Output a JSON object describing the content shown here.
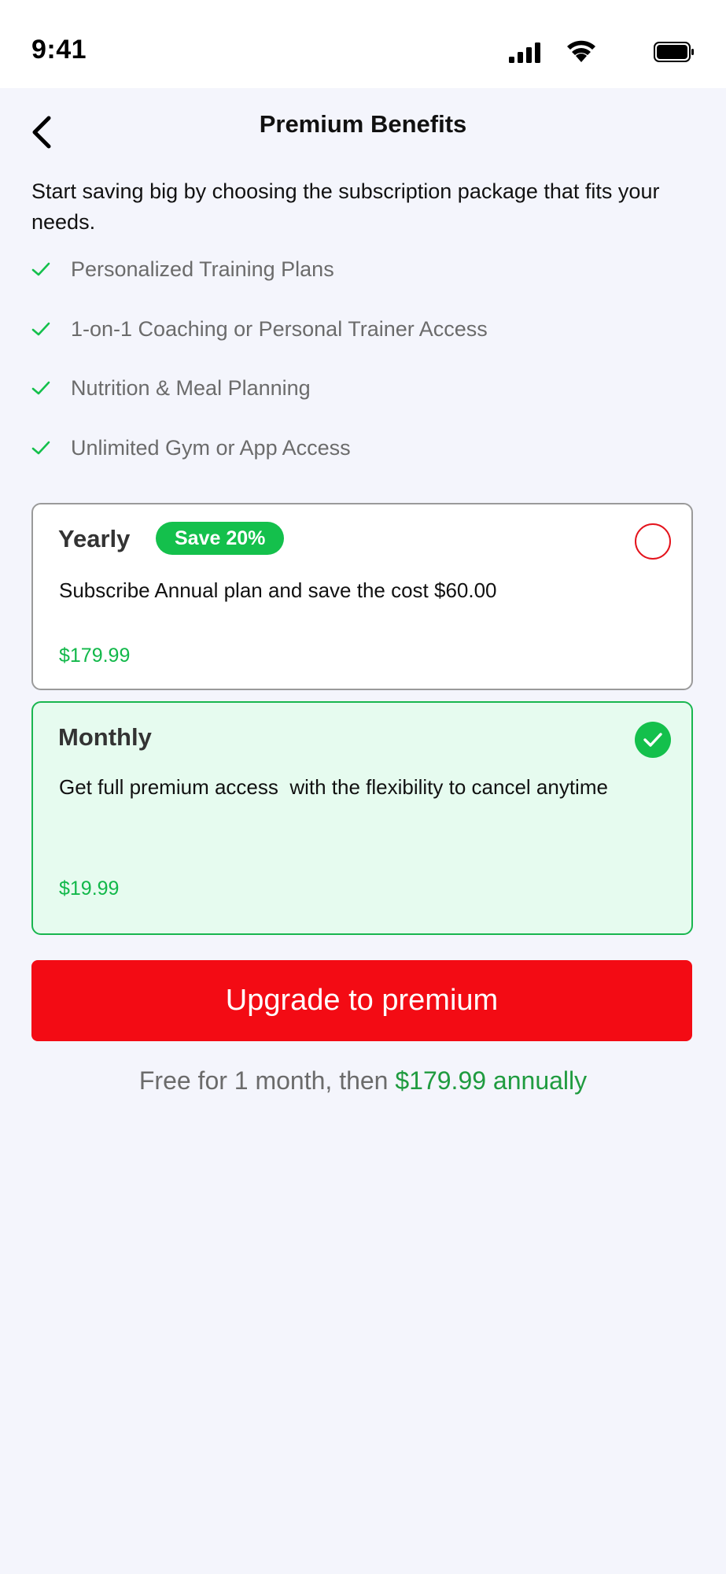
{
  "status_bar": {
    "time": "9:41",
    "icons": [
      "signal-icon",
      "wifi-icon",
      "battery-icon"
    ]
  },
  "header": {
    "title": "Premium Benefits",
    "back_icon": "chevron-left-icon"
  },
  "intro_text": "Start saving big by choosing the subscription package that fits your needs.",
  "benefits": [
    "Personalized Training Plans",
    "1-on-1 Coaching or Personal Trainer Access",
    "Nutrition & Meal Planning",
    "Unlimited Gym or App Access"
  ],
  "plans": {
    "yearly": {
      "name": "Yearly",
      "badge": "Save 20%",
      "description": "Subscribe Annual plan and save the cost $60.00",
      "price": "$179.99",
      "selected": false
    },
    "monthly": {
      "name": "Monthly",
      "description": "Get full premium access  with the flexibility to cancel anytime",
      "price": "$19.99",
      "selected": true
    }
  },
  "upgrade_button": "Upgrade to premium",
  "footnote": {
    "prefix": "Free for 1 month, then ",
    "price": "$179.99 annually"
  },
  "colors": {
    "accent_red": "#f30b14",
    "accent_green": "#14c04c",
    "price_green": "#12b84a",
    "selected_card_bg": "#e6fbef",
    "page_bg": "#f4f5fc"
  }
}
